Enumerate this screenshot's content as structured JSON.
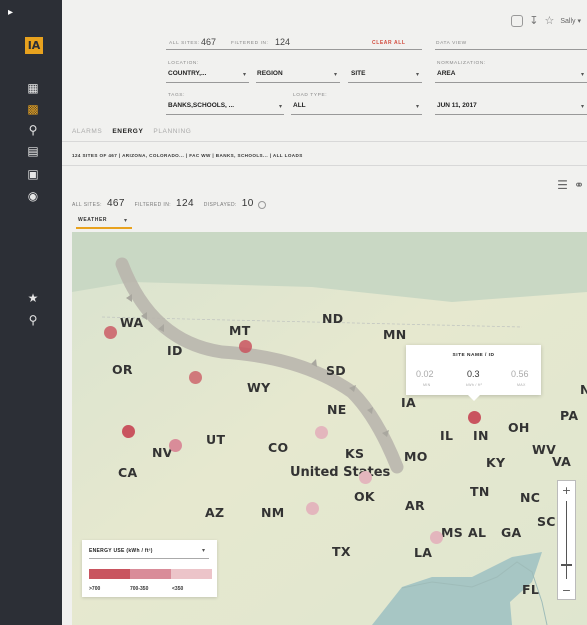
{
  "sidebar": {
    "logo": "IA",
    "items": [
      "dashboard-icon",
      "chart-icon",
      "search-chart-icon",
      "report-icon",
      "clipboard-icon",
      "settings-icon",
      "star-icon",
      "search-icon"
    ]
  },
  "topbar": {
    "user": "Sally ▾"
  },
  "filters": {
    "all_sites_label": "ALL SITES:",
    "all_sites_value": "467",
    "filtered_label": "FILTERED IN:",
    "filtered_value": "124",
    "clear_all": "CLEAR ALL",
    "data_view_label": "DATA VIEW",
    "location_label": "LOCATION:",
    "country": "COUNTRY,...",
    "region": "REGION",
    "site": "SITE",
    "normalization_label": "NORMALIZATION:",
    "normalization": "AREA",
    "tags_label": "TAGS:",
    "tags": "BANKS,SCHOOLS, ...",
    "load_type_label": "LOAD TYPE:",
    "load_type": "ALL",
    "date": "JUN 11, 2017"
  },
  "tabs": [
    {
      "label": "ALARMS",
      "active": false
    },
    {
      "label": "ENERGY",
      "active": true
    },
    {
      "label": "PLANNING",
      "active": false
    }
  ],
  "breadcrumb": "124 SITES OF 467 | ARIZONA, COLORADO... | FAC WW | BANKS, SCHOOLS... | ALL LOADS",
  "counts": {
    "all_label": "ALL SITES:",
    "all_value": "467",
    "filtered_label": "FILTERED IN:",
    "filtered_value": "124",
    "displayed_label": "DISPLAYED:",
    "displayed_value": "10"
  },
  "weather_label": "WEATHER",
  "map": {
    "country": "United States",
    "states": [
      "WA",
      "MT",
      "ND",
      "MN",
      "OR",
      "ID",
      "SD",
      "WY",
      "NE",
      "IA",
      "IL",
      "IN",
      "OH",
      "PA",
      "NV",
      "UT",
      "CO",
      "KS",
      "MO",
      "KY",
      "WV",
      "VA",
      "CA",
      "OK",
      "TN",
      "NC",
      "AZ",
      "NM",
      "AR",
      "SC",
      "TX",
      "LA",
      "MS",
      "AL",
      "GA",
      "FL",
      "N"
    ],
    "pin_colors": {
      "high": "#c9545f",
      "mid": "#d98c99",
      "low": "#e3b6bd"
    }
  },
  "tooltip": {
    "title": "SITE NAME / ID",
    "min_value": "0.02",
    "min_label": "MIN",
    "value": "0.3",
    "value_label": "kWh / ft²",
    "max_value": "0.56",
    "max_label": "MAX"
  },
  "legend": {
    "title": "ENERGY USE (kWh / ft²)",
    "labels": [
      ">700",
      "700-350",
      "<350"
    ],
    "colors": [
      "#c9545f",
      "#d98c99",
      "#ecc4c9"
    ]
  }
}
